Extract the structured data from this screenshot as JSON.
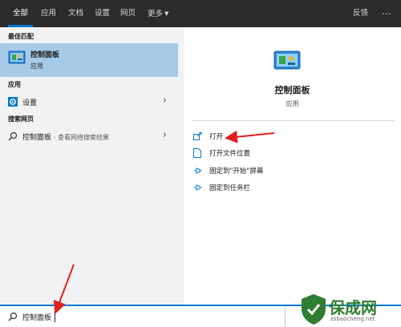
{
  "tabs": [
    {
      "label": "全部",
      "active": true
    },
    {
      "label": "应用"
    },
    {
      "label": "文档"
    },
    {
      "label": "设置"
    },
    {
      "label": "网页"
    },
    {
      "label": "更多"
    }
  ],
  "feedback_label": "反馈",
  "more_icon": "⋯",
  "left": {
    "best_match_header": "最佳匹配",
    "best_match": {
      "title": "控制面板",
      "subtitle": "应用",
      "icon": "control-panel-icon"
    },
    "apps_header": "应用",
    "settings_item": {
      "label": "设置",
      "icon": "gear-icon"
    },
    "web_header": "搜索网页",
    "web_item": {
      "label": "控制面板",
      "suffix": " - 查看网络搜索结果",
      "icon": "search-icon"
    }
  },
  "right": {
    "title": "控制面板",
    "subtitle": "应用",
    "actions": [
      {
        "label": "打开",
        "icon": "open-icon"
      },
      {
        "label": "打开文件位置",
        "icon": "file-location-icon"
      },
      {
        "label": "固定到\"开始\"屏幕",
        "icon": "pin-start-icon"
      },
      {
        "label": "固定到任务栏",
        "icon": "pin-taskbar-icon"
      }
    ]
  },
  "search": {
    "value": "控制面板",
    "icon": "search-icon"
  },
  "watermark": {
    "text": "保成网",
    "url": "zsbaocheng.net"
  },
  "colors": {
    "accent": "#0078d4",
    "highlight": "#a6cbe8",
    "topbar": "#2b2b2b",
    "arrow": "#e02020"
  }
}
